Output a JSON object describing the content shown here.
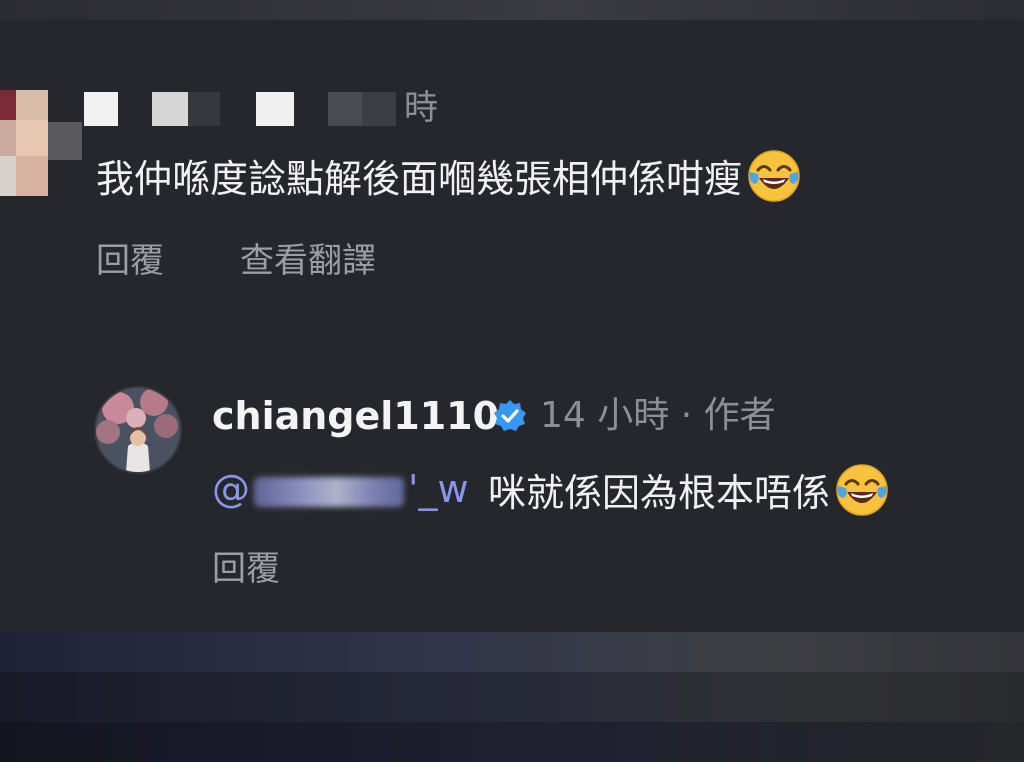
{
  "top_comment": {
    "time_suffix": "時",
    "text": "我仲喺度諗點解後面嗰幾張相仲係咁瘦",
    "emoji_name": "face-with-tears-of-joy-icon",
    "actions": {
      "reply": "回覆",
      "translate": "查看翻譯"
    }
  },
  "reply_comment": {
    "username": "chiangel1110",
    "verified_icon": "verified-badge-icon",
    "meta": "14 小時 · 作者",
    "mention_prefix": "@",
    "mention_suffix": "'_w",
    "text": "咪就係因為根本唔係",
    "emoji_name": "face-with-tears-of-joy-icon",
    "actions": {
      "reply": "回覆"
    }
  },
  "colors": {
    "background": "#26272c",
    "primary_text": "#f1f1f3",
    "secondary_text": "#8d8f95",
    "mention": "#8b95e8",
    "verified": "#3897f0"
  }
}
